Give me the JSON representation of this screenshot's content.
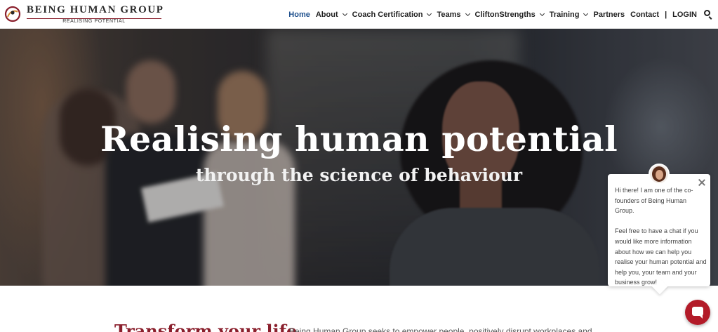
{
  "brand": {
    "title": "BEING HUMAN GROUP",
    "tagline": "REALISING POTENTIAL",
    "accent_color": "#8a1f2c"
  },
  "nav": {
    "items": [
      {
        "label": "Home",
        "active": true,
        "has_dropdown": false
      },
      {
        "label": "About",
        "active": false,
        "has_dropdown": true
      },
      {
        "label": "Coach Certification",
        "active": false,
        "has_dropdown": true
      },
      {
        "label": "Teams",
        "active": false,
        "has_dropdown": true
      },
      {
        "label": "CliftonStrengths",
        "active": false,
        "has_dropdown": true
      },
      {
        "label": "Training",
        "active": false,
        "has_dropdown": true
      },
      {
        "label": "Partners",
        "active": false,
        "has_dropdown": false
      },
      {
        "label": "Contact",
        "active": false,
        "has_dropdown": false
      }
    ],
    "separator": "|",
    "login_label": "LOGIN",
    "search_icon": "search-icon",
    "active_color": "#1d4f8c"
  },
  "hero": {
    "title": "Realising human potential",
    "subtitle": "through the science of behaviour"
  },
  "chat": {
    "message_1": "Hi there! I am one of the co-founders of Being Human Group.",
    "message_2": "Feel free to have a chat if you would like more information about how we can help you realise your human potential and help you, your team and your business grow!",
    "close_icon": "close-icon",
    "launcher_icon": "chat-bubble-icon",
    "launcher_color": "#b31b29"
  },
  "content": {
    "heading": "Transform your life",
    "intro": "Being Human Group seeks to empower people, positively disrupt workplaces and"
  }
}
